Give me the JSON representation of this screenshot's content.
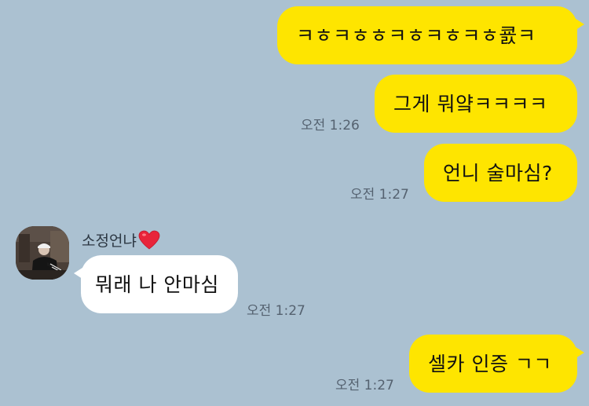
{
  "colors": {
    "background": "#abc1d1",
    "my_bubble": "#fee500",
    "their_bubble": "#ffffff"
  },
  "messages": {
    "m1": {
      "text": "ㅋㅎㅋㅎㅎㅋㅎㅋㅎㅋㅎ쿐ㅋ",
      "time": ""
    },
    "m2": {
      "text": "그게 뭐얔ㅋㅋㅋㅋ",
      "time": "오전 1:26"
    },
    "m3": {
      "text": "언니 술마심?",
      "time": "오전 1:27"
    },
    "m4": {
      "sender": "소정언냐",
      "sender_icon": "red-heart-icon",
      "text": "뭐래 나 안마심",
      "time": "오전 1:27"
    },
    "m5": {
      "text": "셀카 인증 ㄱㄱ",
      "time": "오전 1:27"
    }
  }
}
